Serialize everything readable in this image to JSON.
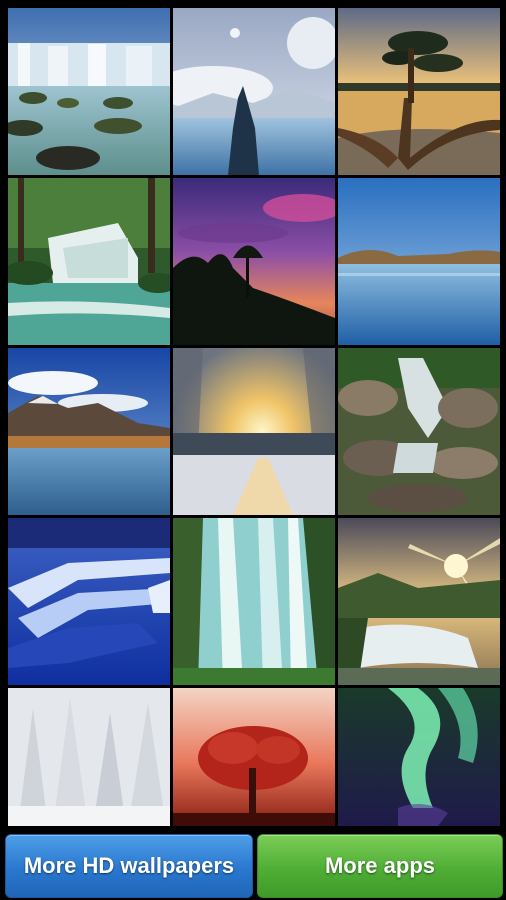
{
  "wallpapers": [
    {
      "id": 1,
      "subject": "waterfall-cliffs"
    },
    {
      "id": 2,
      "subject": "moon-mountain-lake"
    },
    {
      "id": 3,
      "subject": "tree-sunset-lake"
    },
    {
      "id": 4,
      "subject": "forest-waterfall"
    },
    {
      "id": 5,
      "subject": "purple-sky-tree"
    },
    {
      "id": 6,
      "subject": "calm-lake"
    },
    {
      "id": 7,
      "subject": "mountain-lake"
    },
    {
      "id": 8,
      "subject": "snowy-forest-sun"
    },
    {
      "id": 9,
      "subject": "rocky-stream"
    },
    {
      "id": 10,
      "subject": "blue-terraces"
    },
    {
      "id": 11,
      "subject": "tall-waterfall"
    },
    {
      "id": 12,
      "subject": "sunset-cascade"
    },
    {
      "id": 13,
      "subject": "snow-trees"
    },
    {
      "id": 14,
      "subject": "red-tree"
    },
    {
      "id": 15,
      "subject": "aurora"
    }
  ],
  "footer": {
    "more_wallpapers_label": "More HD wallpapers",
    "more_apps_label": "More apps"
  },
  "colors": {
    "more_wallpapers_button": "#2a78cf",
    "more_apps_button": "#4fae35",
    "background": "#000000"
  }
}
